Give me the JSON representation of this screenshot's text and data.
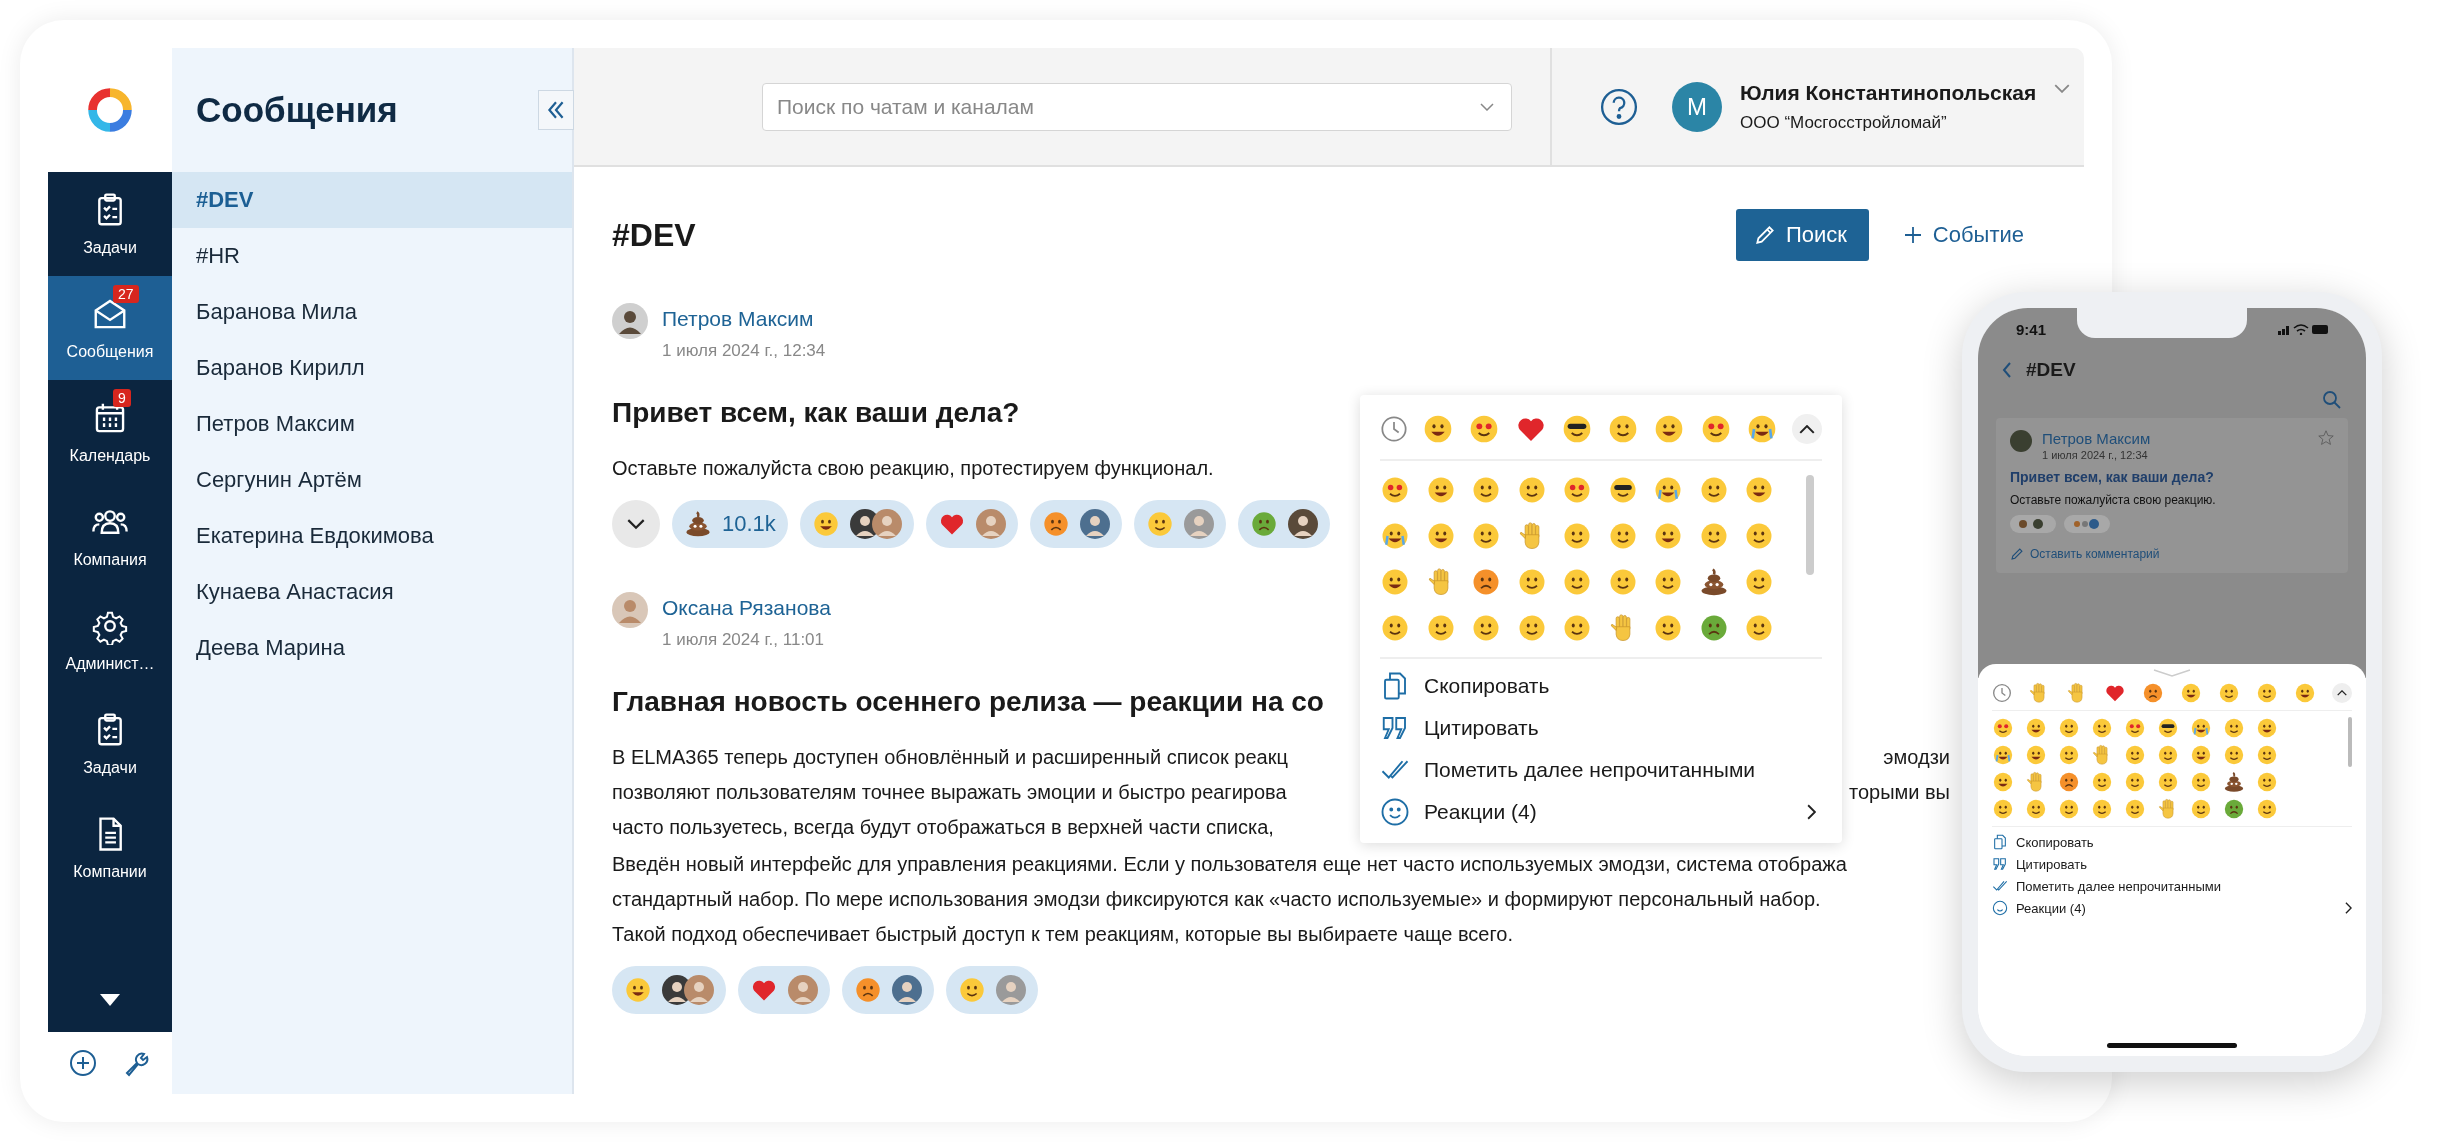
{
  "app_nav": {
    "items": [
      {
        "label": "Задачи",
        "selected": false
      },
      {
        "label": "Сообщения",
        "selected": true,
        "badge": "27"
      },
      {
        "label": "Календарь",
        "selected": false,
        "badge": "9"
      },
      {
        "label": "Компания",
        "selected": false
      },
      {
        "label": "Админист…",
        "selected": false
      },
      {
        "label": "Задачи",
        "selected": false
      },
      {
        "label": "Компании",
        "selected": false
      }
    ]
  },
  "channel_panel": {
    "title": "Сообщения",
    "items": [
      {
        "label": "#DEV",
        "selected": true
      },
      {
        "label": "#HR",
        "selected": false
      },
      {
        "label": "Баранова Мила",
        "selected": false
      },
      {
        "label": "Баранов Кирилл",
        "selected": false
      },
      {
        "label": "Петров Максим",
        "selected": false
      },
      {
        "label": "Сергунин Артём",
        "selected": false
      },
      {
        "label": "Екатерина Евдокимова",
        "selected": false
      },
      {
        "label": "Кунаева Анастасия",
        "selected": false
      },
      {
        "label": "Деева Марина",
        "selected": false
      }
    ]
  },
  "header": {
    "search": {
      "placeholder": "Поиск по чатам и каналам"
    },
    "user": {
      "initial": "М",
      "name": "Юлия Константинопольская",
      "company": "ООО “Мосгосстройломай”"
    }
  },
  "chat": {
    "title": "#DEV",
    "buttons": [
      {
        "label": "Поиск",
        "kind": "primary"
      },
      {
        "label": "Событие",
        "kind": "link"
      }
    ],
    "messages": [
      {
        "author": "Петров Максим",
        "date": "1 июля 2024 г., 12:34",
        "heading": "Привет всем, как ваши дела?",
        "paragraphs": [
          {
            "lines": [
              {
                "left": "Оставьте пожалуйста свою реакцию, протестируем функционал."
              }
            ]
          }
        ],
        "expand": true,
        "reactions": [
          {
            "kind": "count",
            "count": "10.1k"
          },
          {
            "kind": "users"
          },
          {
            "kind": "users"
          },
          {
            "kind": "users"
          },
          {
            "kind": "users"
          },
          {
            "kind": "users"
          }
        ]
      },
      {
        "author": "Оксана Рязанова",
        "date": "1 июля 2024 г., 11:01",
        "heading": "Главная новость осеннего релиза — реакции на со",
        "paragraphs": [
          {
            "lines": [
              {
                "left": "В ELMA365 теперь доступен обновлённый и расширенный список реакц",
                "right": "эмодзи"
              },
              {
                "left": "позволяют пользователям точнее выражать эмоции и быстро реагирова",
                "right": "торыми вы"
              },
              {
                "left": "часто пользуетесь, всегда будут отображаться в верхней части списка,"
              }
            ]
          },
          {
            "lines": [
              {
                "left": "Введён новый интерфейс для управления реакциями. Если у пользователя еще нет часто используемых эмодзи, система отобража"
              },
              {
                "left": "стандартный набор. По мере использования эмодзи фиксируются как «часто используемые» и формируют персональный набор."
              },
              {
                "left": "Такой подход обеспечивает быстрый доступ к тем реакциям, которые вы выбираете чаще всего."
              }
            ]
          }
        ],
        "expand": false,
        "reactions": [
          {
            "kind": "users"
          },
          {
            "kind": "users"
          },
          {
            "kind": "users"
          },
          {
            "kind": "users"
          }
        ]
      }
    ]
  },
  "emoji_popup": {
    "menu": [
      {
        "label": "Скопировать",
        "submenu": false
      },
      {
        "label": "Цитировать",
        "submenu": false
      },
      {
        "label": "Пометить далее непрочитанными",
        "submenu": false
      },
      {
        "label": "Реакции (4)",
        "submenu": true
      }
    ]
  },
  "phone": {
    "time": "9:41",
    "title": "#DEV",
    "message": {
      "author": "Петров Максим",
      "date": "1 июля 2024 г., 12:34",
      "heading": "Привет всем, как ваши дела?",
      "text": "Оставьте пожалуйста свою реакцию.",
      "comment": "Оставить комментарий"
    },
    "menu": [
      {
        "label": "Скопировать",
        "submenu": false
      },
      {
        "label": "Цитировать",
        "submenu": false
      },
      {
        "label": "Пометить далее непрочитанными",
        "submenu": false
      },
      {
        "label": "Реакции (4)",
        "submenu": true
      }
    ]
  }
}
